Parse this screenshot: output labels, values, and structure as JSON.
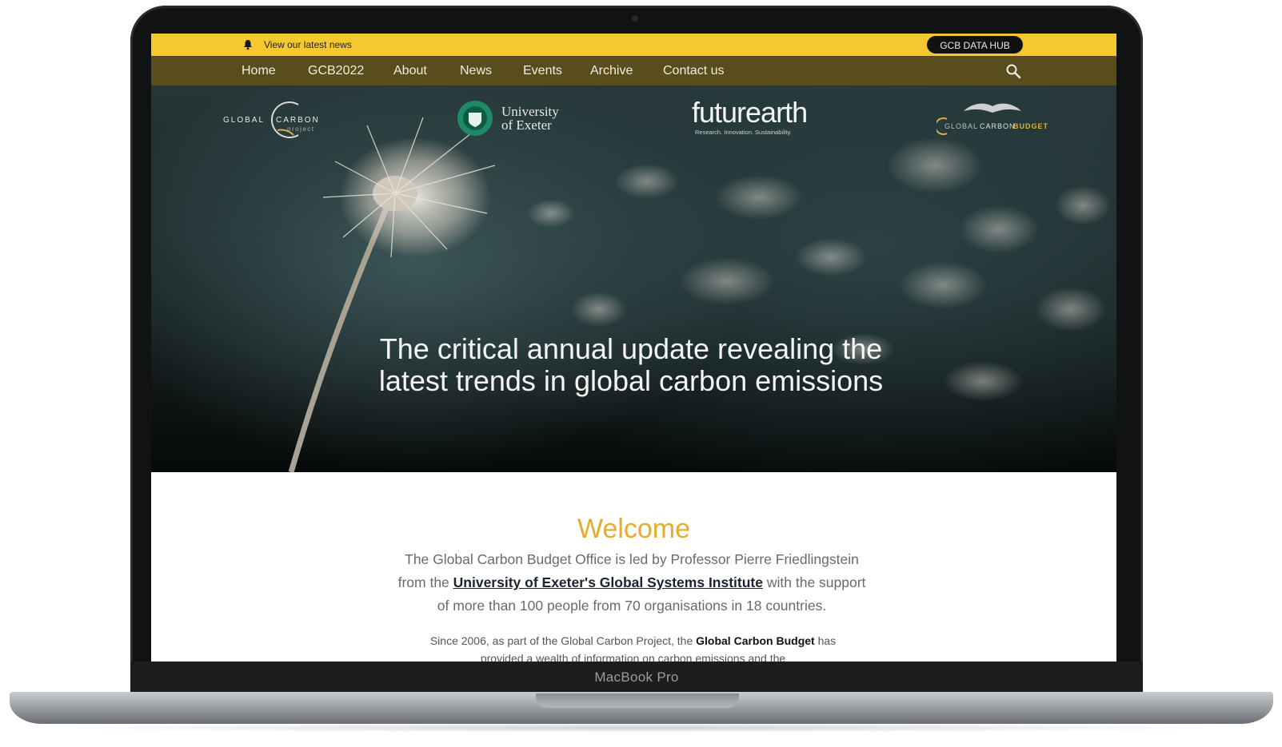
{
  "device": {
    "label": "MacBook Pro"
  },
  "topbar": {
    "news_link": "View our latest news",
    "data_hub_button": "GCB DATA HUB"
  },
  "nav": {
    "items": [
      "Home",
      "GCB2022",
      "About",
      "News",
      "Events",
      "Archive",
      "Contact us"
    ]
  },
  "logos": {
    "gcp": {
      "word1": "GLOBAL",
      "word2": "CARBON",
      "word3": "project"
    },
    "exeter": {
      "line1": "University",
      "line2": "of Exeter"
    },
    "futureearth": {
      "name": "futurearth",
      "tagline": "Research. Innovation. Sustainability."
    },
    "gcb": {
      "text1": "GLOBAL",
      "text2": "CARBON",
      "text3": "BUDGET"
    }
  },
  "hero": {
    "title": "The critical annual update revealing the latest trends in global carbon emissions"
  },
  "welcome": {
    "heading": "Welcome",
    "p1_before": "The Global Carbon Budget Office is led by Professor Pierre Friedlingstein from the ",
    "p1_link": "University of Exeter's Global Systems Institute",
    "p1_after": " with the support of more than 100 people from 70 organisations in 18 countries.",
    "p2_before": "Since 2006, as part of the Global Carbon Project, the ",
    "p2_bold": "Global Carbon Budget",
    "p2_after": " has provided a wealth of information on carbon emissions and the"
  },
  "colors": {
    "topbar": "#f5c92d",
    "navbar": "#5a4d1d",
    "welcome_heading": "#e6ad2c"
  }
}
